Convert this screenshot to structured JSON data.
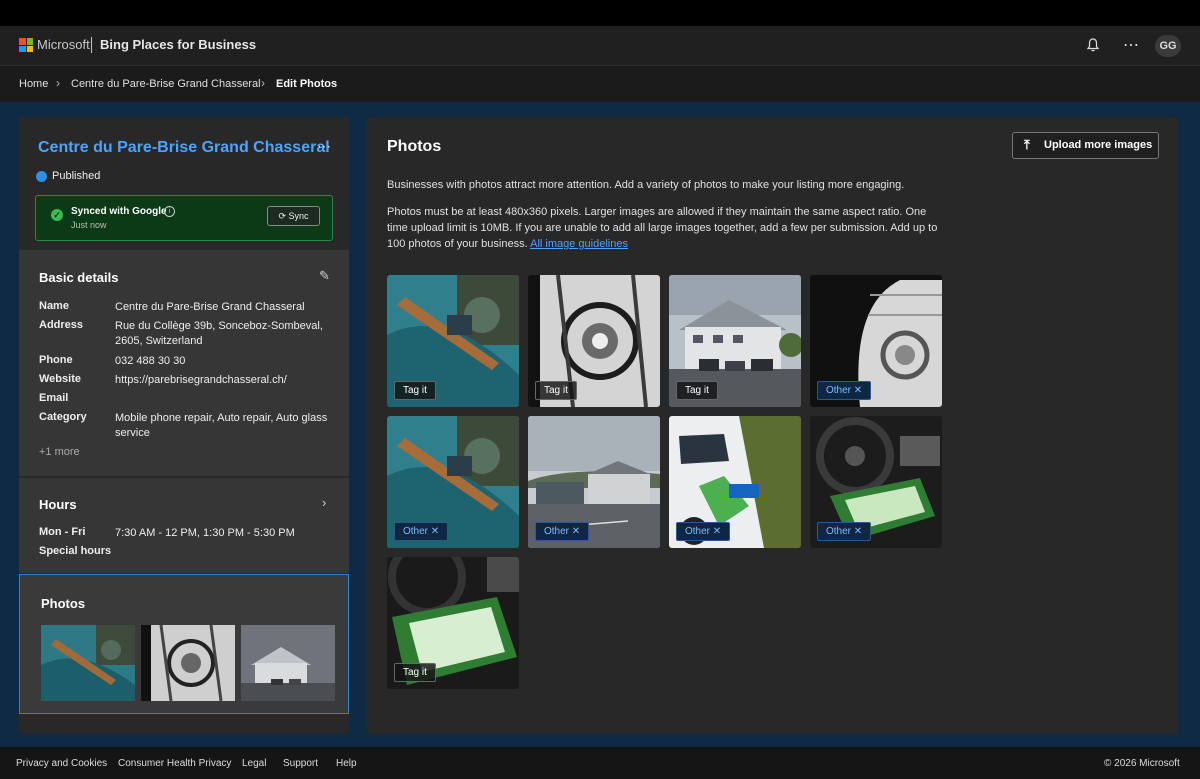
{
  "header": {
    "brand": "Microsoft",
    "product": "Bing Places for Business",
    "avatar_initials": "GG",
    "icons": [
      "bell-icon",
      "more-icon"
    ]
  },
  "breadcrumb": {
    "items": [
      "Home",
      "Centre du Pare-Brise Grand Chasseral",
      "Edit Photos"
    ]
  },
  "sidebar": {
    "business_name": "Centre du Pare-Brise Grand Chasseral",
    "status": "Published",
    "sync": {
      "title": "Synced with Google",
      "subtitle": "Just now",
      "button": "Sync"
    },
    "basic_details": {
      "title": "Basic details",
      "rows": [
        {
          "label": "Name",
          "value": "Centre du Pare-Brise Grand Chasseral"
        },
        {
          "label": "Address",
          "value": "Rue du Collège 39b, Sonceboz-Sombeval, 2605, Switzerland"
        },
        {
          "label": "Phone",
          "value": "032 488 30 30"
        },
        {
          "label": "Website",
          "value": "https://parebrisegrandchasseral.ch/"
        },
        {
          "label": "Email",
          "value": ""
        },
        {
          "label": "Category",
          "value": "Mobile phone repair, Auto repair, Auto glass service"
        }
      ],
      "more": "+1 more"
    },
    "hours": {
      "title": "Hours",
      "days": "Mon - Fri",
      "times": "7:30 AM - 12 PM, 1:30 PM - 5:30 PM",
      "special": "Special hours"
    },
    "photos": {
      "title": "Photos"
    }
  },
  "main": {
    "title": "Photos",
    "upload_button": "Upload more images",
    "intro": "Businesses with photos attract more attention. Add a variety of photos to make your listing more engaging.",
    "guidelines_text": "Photos must be at least 480x360 pixels. Larger images are allowed if they maintain the same aspect ratio. One time upload limit is 10MB. If you are unable to add all large images together, add a few per submission. Add up to 100 photos of your business.",
    "guidelines_link": "All image guidelines",
    "photos": [
      {
        "tag": "Tag it"
      },
      {
        "tag": "Tag it"
      },
      {
        "tag": "Tag it"
      },
      {
        "tag": "Other"
      },
      {
        "tag": "Other"
      },
      {
        "tag": "Other"
      },
      {
        "tag": "Other"
      },
      {
        "tag": "Other"
      },
      {
        "tag": "Tag it"
      }
    ]
  },
  "footer": {
    "links": [
      "Privacy and Cookies",
      "Consumer Health Privacy",
      "Legal",
      "Support",
      "Help"
    ],
    "copyright": "© 2026 Microsoft"
  },
  "colors": {
    "accent": "#4da3ff",
    "synced_bg": "#0d3a16",
    "selected_border": "#2f7ed8"
  }
}
